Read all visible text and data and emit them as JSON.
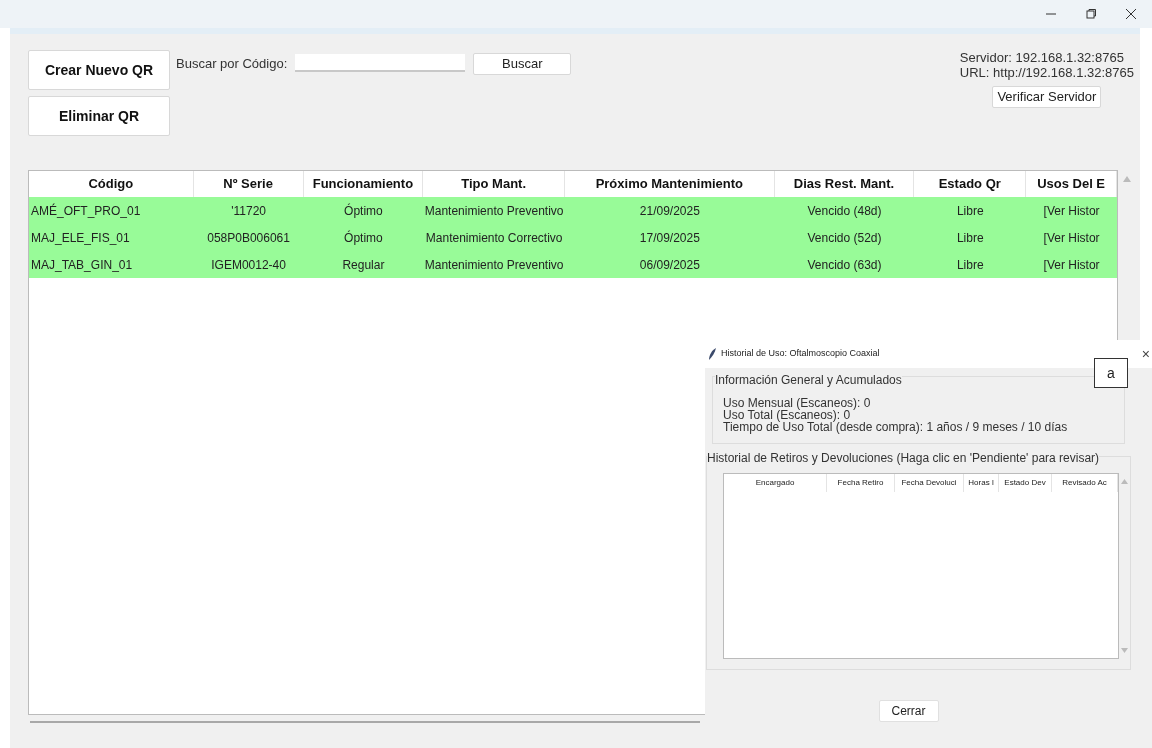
{
  "toolbar": {
    "create_button": "Crear Nuevo QR",
    "delete_button": "Eliminar QR",
    "search_label": "Buscar por Código:",
    "search_button": "Buscar"
  },
  "server": {
    "server_line": "Servidor: 192.168.1.32:8765",
    "url_line": "URL: http://192.168.1.32:8765",
    "verify_button": "Verificar Servidor"
  },
  "table": {
    "columns": [
      "Código",
      "Nº Serie",
      "Funcionamiento",
      "Tipo Mant.",
      "Próximo Mantenimiento",
      "Dias Rest. Mant.",
      "Estado Qr",
      "Usos Del E"
    ],
    "rows": [
      {
        "cells": [
          "AMÉ_OFT_PRO_01",
          "'11720",
          "Óptimo",
          "Mantenimiento Preventivo",
          "21/09/2025",
          "Vencido (48d)",
          "Libre",
          "[Ver Histor"
        ]
      },
      {
        "cells": [
          "MAJ_ELE_FIS_01",
          "058P0B006061",
          "Óptimo",
          "Mantenimiento Correctivo",
          "17/09/2025",
          "Vencido (52d)",
          "Libre",
          "[Ver Histor"
        ]
      },
      {
        "cells": [
          "MAJ_TAB_GIN_01",
          "IGEM0012-40",
          "Regular",
          "Mantenimiento Preventivo",
          "06/09/2025",
          "Vencido (63d)",
          "Libre",
          "[Ver Histor"
        ]
      }
    ]
  },
  "dialog": {
    "title": "Historial de Uso: Oftalmoscopio Coaxial",
    "close": "×",
    "tag": "a",
    "general": {
      "title": "Información General y Acumulados",
      "lines": [
        "Uso Mensual (Escaneos): 0",
        "Uso Total (Escaneos): 0",
        "Tiempo de Uso Total (desde compra): 1 años / 9 meses / 10 días"
      ]
    },
    "history": {
      "title": "Historial de Retiros y Devoluciones (Haga clic en 'Pendiente' para revisar)",
      "columns": [
        "Encargado",
        "Fecha Retiro",
        "Fecha Devoluci",
        "Horas l",
        "Estado Dev",
        "Revisado Ac"
      ]
    },
    "close_button": "Cerrar"
  }
}
